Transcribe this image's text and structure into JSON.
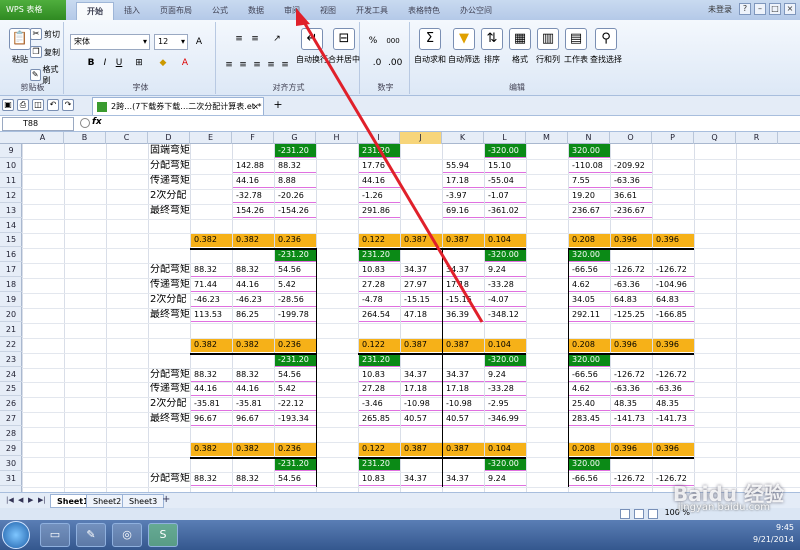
{
  "app": {
    "button_label": "WPS 表格",
    "user": "未登录"
  },
  "menu_tabs": [
    "开始",
    "插入",
    "页面布局",
    "公式",
    "数据",
    "审阅",
    "视图",
    "开发工具",
    "表格特色",
    "办公空间"
  ],
  "ribbon": {
    "clipboard": {
      "paste": "粘贴",
      "cut": "剪切",
      "copy": "复制",
      "format_painter": "格式刷",
      "label": "剪贴板"
    },
    "font": {
      "name": "宋体",
      "size": "12",
      "bold": "B",
      "italic": "I",
      "underline": "U",
      "label": "字体"
    },
    "alignment": {
      "label": "对齐方式",
      "wrap": "自动换行",
      "merge": "合并居中"
    },
    "number": {
      "label": "数字",
      "percent": "%",
      "thousands": "000"
    },
    "editing": {
      "sum": "自动求和",
      "filter": "自动筛选",
      "sort": "排序",
      "format": "格式",
      "rows_cols": "行和列",
      "worksheet": "工作表",
      "find": "查找选择",
      "label": "编辑"
    }
  },
  "doc_tab": {
    "title": "2跨…(7下载券下载…二次分配计算表.et *",
    "close": "×",
    "add": "+"
  },
  "formula_bar": {
    "name_box": "T88",
    "fx": "fx"
  },
  "columns": [
    "A",
    "B",
    "C",
    "D",
    "E",
    "F",
    "G",
    "H",
    "I",
    "J",
    "K",
    "L",
    "M",
    "N",
    "O",
    "P",
    "Q",
    "R"
  ],
  "selected_column": "J",
  "rows": [
    "9",
    "10",
    "11",
    "12",
    "13",
    "14",
    "15",
    "16",
    "17",
    "18",
    "19",
    "20",
    "21",
    "22",
    "23",
    "24",
    "25",
    "26",
    "27",
    "28",
    "29",
    "30",
    "31"
  ],
  "cells": [
    {
      "r": 0,
      "c": 3,
      "v": "固端弯矩",
      "t": "lbl"
    },
    {
      "r": 0,
      "c": 6,
      "v": "-231.20",
      "t": "g"
    },
    {
      "r": 0,
      "c": 8,
      "v": "231.20",
      "t": "g"
    },
    {
      "r": 0,
      "c": 11,
      "v": "-320.00",
      "t": "g"
    },
    {
      "r": 0,
      "c": 13,
      "v": "320.00",
      "t": "g"
    },
    {
      "r": 1,
      "c": 3,
      "v": "分配弯矩",
      "t": "lbl"
    },
    {
      "r": 1,
      "c": 5,
      "v": "142.88"
    },
    {
      "r": 1,
      "c": 6,
      "v": "88.32"
    },
    {
      "r": 1,
      "c": 8,
      "v": "17.76"
    },
    {
      "r": 1,
      "c": 10,
      "v": "55.94"
    },
    {
      "r": 1,
      "c": 11,
      "v": "15.10"
    },
    {
      "r": 1,
      "c": 13,
      "v": "-110.08"
    },
    {
      "r": 1,
      "c": 14,
      "v": "-209.92"
    },
    {
      "r": 2,
      "c": 3,
      "v": "传递弯矩",
      "t": "lbl"
    },
    {
      "r": 2,
      "c": 5,
      "v": "44.16"
    },
    {
      "r": 2,
      "c": 6,
      "v": "8.88"
    },
    {
      "r": 2,
      "c": 8,
      "v": "44.16"
    },
    {
      "r": 2,
      "c": 10,
      "v": "17.18"
    },
    {
      "r": 2,
      "c": 11,
      "v": "-55.04"
    },
    {
      "r": 2,
      "c": 13,
      "v": "7.55"
    },
    {
      "r": 2,
      "c": 14,
      "v": "-63.36"
    },
    {
      "r": 3,
      "c": 3,
      "v": "2次分配",
      "t": "lbl"
    },
    {
      "r": 3,
      "c": 5,
      "v": "-32.78"
    },
    {
      "r": 3,
      "c": 6,
      "v": "-20.26"
    },
    {
      "r": 3,
      "c": 8,
      "v": "-1.26"
    },
    {
      "r": 3,
      "c": 10,
      "v": "-3.97"
    },
    {
      "r": 3,
      "c": 11,
      "v": "-1.07"
    },
    {
      "r": 3,
      "c": 13,
      "v": "19.20"
    },
    {
      "r": 3,
      "c": 14,
      "v": "36.61"
    },
    {
      "r": 4,
      "c": 3,
      "v": "最终弯矩",
      "t": "lbl"
    },
    {
      "r": 4,
      "c": 5,
      "v": "154.26"
    },
    {
      "r": 4,
      "c": 6,
      "v": "-154.26"
    },
    {
      "r": 4,
      "c": 8,
      "v": "291.86"
    },
    {
      "r": 4,
      "c": 10,
      "v": "69.16"
    },
    {
      "r": 4,
      "c": 11,
      "v": "-361.02"
    },
    {
      "r": 4,
      "c": 13,
      "v": "236.67"
    },
    {
      "r": 4,
      "c": 14,
      "v": "-236.67"
    },
    {
      "r": 6,
      "c": 4,
      "v": "0.382",
      "t": "o"
    },
    {
      "r": 6,
      "c": 5,
      "v": "0.382",
      "t": "o"
    },
    {
      "r": 6,
      "c": 6,
      "v": "0.236",
      "t": "o"
    },
    {
      "r": 6,
      "c": 8,
      "v": "0.122",
      "t": "o"
    },
    {
      "r": 6,
      "c": 9,
      "v": "0.387",
      "t": "o"
    },
    {
      "r": 6,
      "c": 10,
      "v": "0.387",
      "t": "o"
    },
    {
      "r": 6,
      "c": 11,
      "v": "0.104",
      "t": "o"
    },
    {
      "r": 6,
      "c": 13,
      "v": "0.208",
      "t": "o"
    },
    {
      "r": 6,
      "c": 14,
      "v": "0.396",
      "t": "o"
    },
    {
      "r": 6,
      "c": 15,
      "v": "0.396",
      "t": "o"
    },
    {
      "r": 7,
      "c": 6,
      "v": "-231.20",
      "t": "g"
    },
    {
      "r": 7,
      "c": 8,
      "v": "231.20",
      "t": "g"
    },
    {
      "r": 7,
      "c": 11,
      "v": "-320.00",
      "t": "g"
    },
    {
      "r": 7,
      "c": 13,
      "v": "320.00",
      "t": "g"
    },
    {
      "r": 8,
      "c": 3,
      "v": "分配弯矩",
      "t": "lbl"
    },
    {
      "r": 8,
      "c": 4,
      "v": "88.32"
    },
    {
      "r": 8,
      "c": 5,
      "v": "88.32"
    },
    {
      "r": 8,
      "c": 6,
      "v": "54.56"
    },
    {
      "r": 8,
      "c": 8,
      "v": "10.83"
    },
    {
      "r": 8,
      "c": 9,
      "v": "34.37"
    },
    {
      "r": 8,
      "c": 10,
      "v": "34.37"
    },
    {
      "r": 8,
      "c": 11,
      "v": "9.24"
    },
    {
      "r": 8,
      "c": 13,
      "v": "-66.56"
    },
    {
      "r": 8,
      "c": 14,
      "v": "-126.72"
    },
    {
      "r": 8,
      "c": 15,
      "v": "-126.72"
    },
    {
      "r": 9,
      "c": 3,
      "v": "传递弯矩",
      "t": "lbl"
    },
    {
      "r": 9,
      "c": 4,
      "v": "71.44"
    },
    {
      "r": 9,
      "c": 5,
      "v": "44.16"
    },
    {
      "r": 9,
      "c": 6,
      "v": "5.42"
    },
    {
      "r": 9,
      "c": 8,
      "v": "27.28"
    },
    {
      "r": 9,
      "c": 9,
      "v": "27.97"
    },
    {
      "r": 9,
      "c": 10,
      "v": "17.18"
    },
    {
      "r": 9,
      "c": 11,
      "v": "-33.28"
    },
    {
      "r": 9,
      "c": 13,
      "v": "4.62"
    },
    {
      "r": 9,
      "c": 14,
      "v": "-63.36"
    },
    {
      "r": 9,
      "c": 15,
      "v": "-104.96"
    },
    {
      "r": 10,
      "c": 3,
      "v": "2次分配",
      "t": "lbl"
    },
    {
      "r": 10,
      "c": 4,
      "v": "-46.23"
    },
    {
      "r": 10,
      "c": 5,
      "v": "-46.23"
    },
    {
      "r": 10,
      "c": 6,
      "v": "-28.56"
    },
    {
      "r": 10,
      "c": 8,
      "v": "-4.78"
    },
    {
      "r": 10,
      "c": 9,
      "v": "-15.15"
    },
    {
      "r": 10,
      "c": 10,
      "v": "-15.15"
    },
    {
      "r": 10,
      "c": 11,
      "v": "-4.07"
    },
    {
      "r": 10,
      "c": 13,
      "v": "34.05"
    },
    {
      "r": 10,
      "c": 14,
      "v": "64.83"
    },
    {
      "r": 10,
      "c": 15,
      "v": "64.83"
    },
    {
      "r": 11,
      "c": 3,
      "v": "最终弯矩",
      "t": "lbl"
    },
    {
      "r": 11,
      "c": 4,
      "v": "113.53"
    },
    {
      "r": 11,
      "c": 5,
      "v": "86.25"
    },
    {
      "r": 11,
      "c": 6,
      "v": "-199.78"
    },
    {
      "r": 11,
      "c": 8,
      "v": "264.54"
    },
    {
      "r": 11,
      "c": 9,
      "v": "47.18"
    },
    {
      "r": 11,
      "c": 10,
      "v": "36.39"
    },
    {
      "r": 11,
      "c": 11,
      "v": "-348.12"
    },
    {
      "r": 11,
      "c": 13,
      "v": "292.11"
    },
    {
      "r": 11,
      "c": 14,
      "v": "-125.25"
    },
    {
      "r": 11,
      "c": 15,
      "v": "-166.85"
    },
    {
      "r": 13,
      "c": 4,
      "v": "0.382",
      "t": "o"
    },
    {
      "r": 13,
      "c": 5,
      "v": "0.382",
      "t": "o"
    },
    {
      "r": 13,
      "c": 6,
      "v": "0.236",
      "t": "o"
    },
    {
      "r": 13,
      "c": 8,
      "v": "0.122",
      "t": "o"
    },
    {
      "r": 13,
      "c": 9,
      "v": "0.387",
      "t": "o"
    },
    {
      "r": 13,
      "c": 10,
      "v": "0.387",
      "t": "o"
    },
    {
      "r": 13,
      "c": 11,
      "v": "0.104",
      "t": "o"
    },
    {
      "r": 13,
      "c": 13,
      "v": "0.208",
      "t": "o"
    },
    {
      "r": 13,
      "c": 14,
      "v": "0.396",
      "t": "o"
    },
    {
      "r": 13,
      "c": 15,
      "v": "0.396",
      "t": "o"
    },
    {
      "r": 14,
      "c": 6,
      "v": "-231.20",
      "t": "g"
    },
    {
      "r": 14,
      "c": 8,
      "v": "231.20",
      "t": "g"
    },
    {
      "r": 14,
      "c": 11,
      "v": "-320.00",
      "t": "g"
    },
    {
      "r": 14,
      "c": 13,
      "v": "320.00",
      "t": "g"
    },
    {
      "r": 15,
      "c": 3,
      "v": "分配弯矩",
      "t": "lbl"
    },
    {
      "r": 15,
      "c": 4,
      "v": "88.32"
    },
    {
      "r": 15,
      "c": 5,
      "v": "88.32"
    },
    {
      "r": 15,
      "c": 6,
      "v": "54.56"
    },
    {
      "r": 15,
      "c": 8,
      "v": "10.83"
    },
    {
      "r": 15,
      "c": 9,
      "v": "34.37"
    },
    {
      "r": 15,
      "c": 10,
      "v": "34.37"
    },
    {
      "r": 15,
      "c": 11,
      "v": "9.24"
    },
    {
      "r": 15,
      "c": 13,
      "v": "-66.56"
    },
    {
      "r": 15,
      "c": 14,
      "v": "-126.72"
    },
    {
      "r": 15,
      "c": 15,
      "v": "-126.72"
    },
    {
      "r": 16,
      "c": 3,
      "v": "传递弯矩",
      "t": "lbl"
    },
    {
      "r": 16,
      "c": 4,
      "v": "44.16"
    },
    {
      "r": 16,
      "c": 5,
      "v": "44.16"
    },
    {
      "r": 16,
      "c": 6,
      "v": "5.42"
    },
    {
      "r": 16,
      "c": 8,
      "v": "27.28"
    },
    {
      "r": 16,
      "c": 9,
      "v": "17.18"
    },
    {
      "r": 16,
      "c": 10,
      "v": "17.18"
    },
    {
      "r": 16,
      "c": 11,
      "v": "-33.28"
    },
    {
      "r": 16,
      "c": 13,
      "v": "4.62"
    },
    {
      "r": 16,
      "c": 14,
      "v": "-63.36"
    },
    {
      "r": 16,
      "c": 15,
      "v": "-63.36"
    },
    {
      "r": 17,
      "c": 3,
      "v": "2次分配",
      "t": "lbl"
    },
    {
      "r": 17,
      "c": 4,
      "v": "-35.81"
    },
    {
      "r": 17,
      "c": 5,
      "v": "-35.81"
    },
    {
      "r": 17,
      "c": 6,
      "v": "-22.12"
    },
    {
      "r": 17,
      "c": 8,
      "v": "-3.46"
    },
    {
      "r": 17,
      "c": 9,
      "v": "-10.98"
    },
    {
      "r": 17,
      "c": 10,
      "v": "-10.98"
    },
    {
      "r": 17,
      "c": 11,
      "v": "-2.95"
    },
    {
      "r": 17,
      "c": 13,
      "v": "25.40"
    },
    {
      "r": 17,
      "c": 14,
      "v": "48.35"
    },
    {
      "r": 17,
      "c": 15,
      "v": "48.35"
    },
    {
      "r": 18,
      "c": 3,
      "v": "最终弯矩",
      "t": "lbl"
    },
    {
      "r": 18,
      "c": 4,
      "v": "96.67"
    },
    {
      "r": 18,
      "c": 5,
      "v": "96.67"
    },
    {
      "r": 18,
      "c": 6,
      "v": "-193.34"
    },
    {
      "r": 18,
      "c": 8,
      "v": "265.85"
    },
    {
      "r": 18,
      "c": 9,
      "v": "40.57"
    },
    {
      "r": 18,
      "c": 10,
      "v": "40.57"
    },
    {
      "r": 18,
      "c": 11,
      "v": "-346.99"
    },
    {
      "r": 18,
      "c": 13,
      "v": "283.45"
    },
    {
      "r": 18,
      "c": 14,
      "v": "-141.73"
    },
    {
      "r": 18,
      "c": 15,
      "v": "-141.73"
    },
    {
      "r": 20,
      "c": 4,
      "v": "0.382",
      "t": "o"
    },
    {
      "r": 20,
      "c": 5,
      "v": "0.382",
      "t": "o"
    },
    {
      "r": 20,
      "c": 6,
      "v": "0.236",
      "t": "o"
    },
    {
      "r": 20,
      "c": 8,
      "v": "0.122",
      "t": "o"
    },
    {
      "r": 20,
      "c": 9,
      "v": "0.387",
      "t": "o"
    },
    {
      "r": 20,
      "c": 10,
      "v": "0.387",
      "t": "o"
    },
    {
      "r": 20,
      "c": 11,
      "v": "0.104",
      "t": "o"
    },
    {
      "r": 20,
      "c": 13,
      "v": "0.208",
      "t": "o"
    },
    {
      "r": 20,
      "c": 14,
      "v": "0.396",
      "t": "o"
    },
    {
      "r": 20,
      "c": 15,
      "v": "0.396",
      "t": "o"
    },
    {
      "r": 21,
      "c": 6,
      "v": "-231.20",
      "t": "g"
    },
    {
      "r": 21,
      "c": 8,
      "v": "231.20",
      "t": "g"
    },
    {
      "r": 21,
      "c": 11,
      "v": "-320.00",
      "t": "g"
    },
    {
      "r": 21,
      "c": 13,
      "v": "320.00",
      "t": "g"
    },
    {
      "r": 22,
      "c": 3,
      "v": "分配弯矩",
      "t": "lbl"
    },
    {
      "r": 22,
      "c": 4,
      "v": "88.32"
    },
    {
      "r": 22,
      "c": 5,
      "v": "88.32"
    },
    {
      "r": 22,
      "c": 6,
      "v": "54.56"
    },
    {
      "r": 22,
      "c": 8,
      "v": "10.83"
    },
    {
      "r": 22,
      "c": 9,
      "v": "34.37"
    },
    {
      "r": 22,
      "c": 10,
      "v": "34.37"
    },
    {
      "r": 22,
      "c": 11,
      "v": "9.24"
    },
    {
      "r": 22,
      "c": 13,
      "v": "-66.56"
    },
    {
      "r": 22,
      "c": 14,
      "v": "-126.72"
    },
    {
      "r": 22,
      "c": 15,
      "v": "-126.72"
    }
  ],
  "sheets": [
    "Sheet1",
    "Sheet2",
    "Sheet3"
  ],
  "active_sheet": "Sheet1",
  "status": {
    "zoom": "100 %"
  },
  "taskbar": {
    "time": "9:45",
    "date": "9/21/2014"
  },
  "watermark": {
    "brand": "Baidu 经验",
    "url": "jingyan.baidu.com"
  },
  "colors": {
    "green_fill": "#0b8a16",
    "orange_fill": "#f6b118",
    "pink_border": "#e070e0",
    "arrow": "#e0202a"
  }
}
